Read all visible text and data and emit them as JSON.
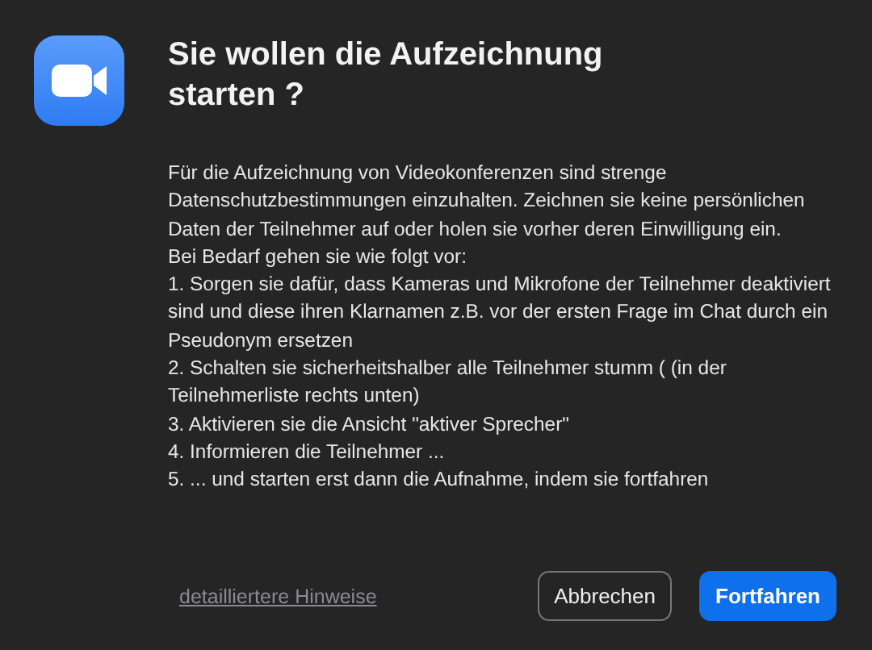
{
  "title": "Sie wollen die Aufzeichnung starten ?",
  "paragraphs": [
    "Für die Aufzeichnung von Videokonferenzen sind strenge Datenschutzbestimmungen einzuhalten. Zeichnen sie keine persönlichen Daten der Teilnehmer auf oder holen sie vorher deren Einwilligung ein.",
    "Bei Bedarf gehen sie wie folgt vor:",
    "1. Sorgen sie dafür, dass Kameras und Mikrofone der Teilnehmer deaktiviert sind und diese ihren Klarnamen z.B. vor der ersten Frage im Chat durch ein Pseudonym ersetzen",
    "2. Schalten sie sicherheitshalber alle Teilnehmer stumm ( (in der Teilnehmerliste rechts unten)",
    "3. Aktivieren sie die Ansicht \"aktiver Sprecher\"",
    "4. Informieren die Teilnehmer ...",
    "5. ... und starten erst dann die Aufnahme, indem sie fortfahren"
  ],
  "link": "detailliertere Hinweise",
  "buttons": [
    {
      "label": "Abbrechen",
      "kind": "secondary"
    },
    {
      "label": "Fortfahren",
      "kind": "primary"
    }
  ]
}
